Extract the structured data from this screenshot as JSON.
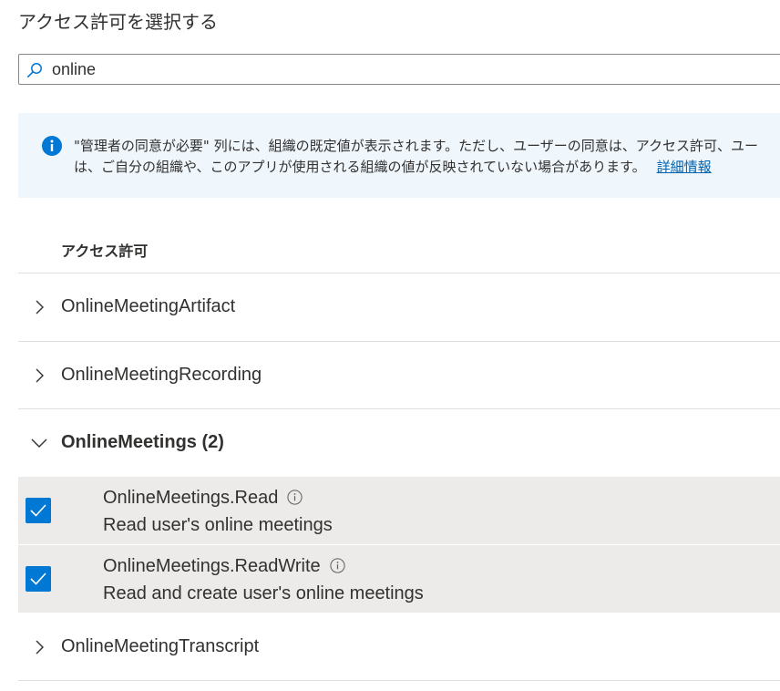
{
  "page": {
    "title": "アクセス許可を選択する"
  },
  "search": {
    "value": "online"
  },
  "info_banner": {
    "line1": "\"管理者の同意が必要\" 列には、組織の既定値が表示されます。ただし、ユーザーの同意は、アクセス許可、ユー",
    "line2": "は、ご自分の組織や、このアプリが使用される組織の値が反映されていない場合があります。",
    "link": "詳細情報"
  },
  "table": {
    "column_header": "アクセス許可",
    "groups": [
      {
        "label": "OnlineMeetingArtifact",
        "expanded": false
      },
      {
        "label": "OnlineMeetingRecording",
        "expanded": false
      },
      {
        "label": "OnlineMeetings (2)",
        "expanded": true,
        "permissions": [
          {
            "name": "OnlineMeetings.Read",
            "description": "Read user's online meetings",
            "checked": true
          },
          {
            "name": "OnlineMeetings.ReadWrite",
            "description": "Read and create user's online meetings",
            "checked": true
          }
        ]
      },
      {
        "label": "OnlineMeetingTranscript",
        "expanded": false
      }
    ]
  },
  "colors": {
    "accent": "#0078d4",
    "link": "#0062ad",
    "info_background": "#eff6fc",
    "selected_row": "#edebe9"
  },
  "icons": {
    "search": "search-icon",
    "info": "info-icon",
    "chevron_right": "chevron-right-icon",
    "chevron_down": "chevron-down-icon",
    "checkmark": "checkmark-icon"
  }
}
